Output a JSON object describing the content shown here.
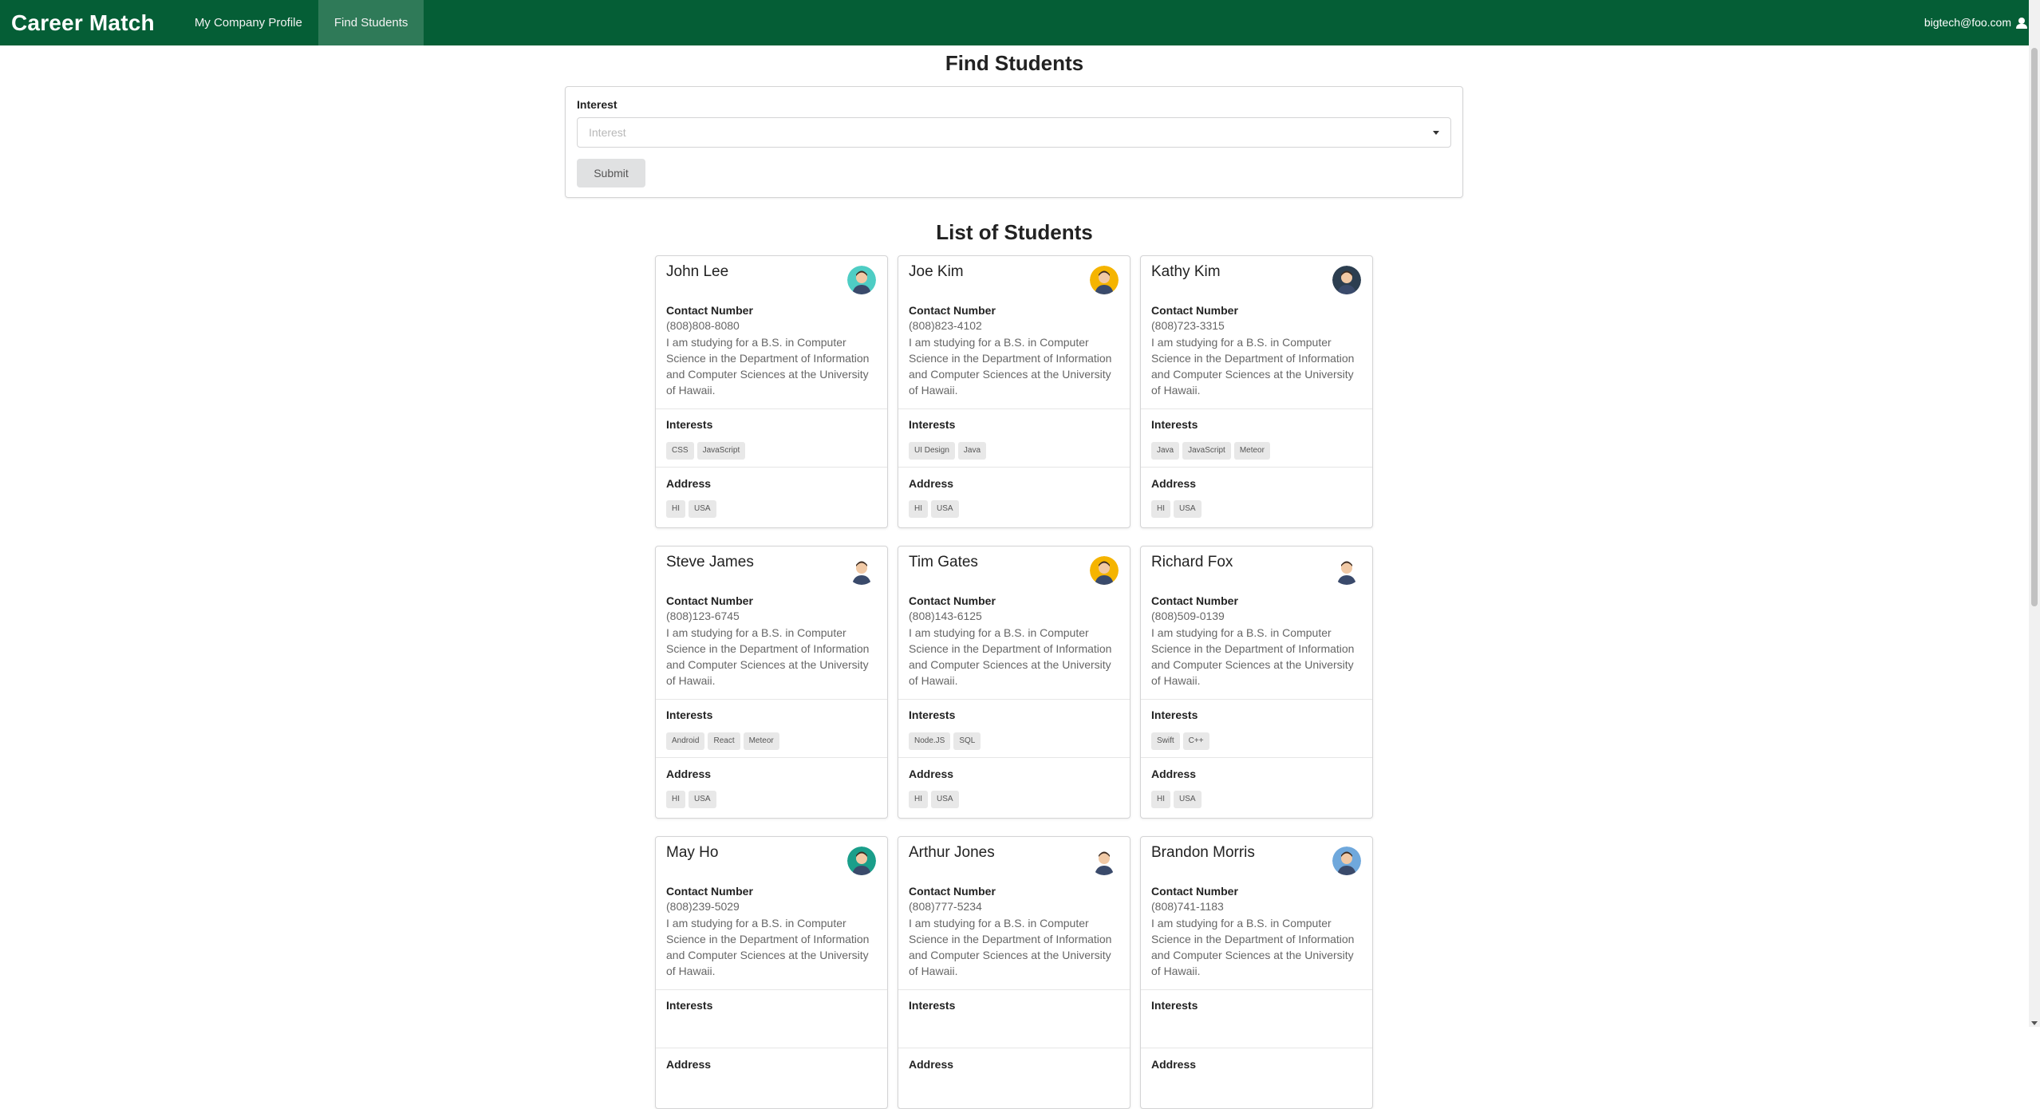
{
  "nav": {
    "brand": "Career Match",
    "items": [
      {
        "label": "My Company Profile"
      },
      {
        "label": "Find Students"
      }
    ],
    "user": "bigtech@foo.com"
  },
  "page_title": "Find Students",
  "form": {
    "label": "Interest",
    "placeholder": "Interest",
    "submit": "Submit"
  },
  "list_title": "List of Students",
  "labels": {
    "contact": "Contact Number",
    "interests": "Interests",
    "address": "Address"
  },
  "students": [
    {
      "name": "John Lee",
      "phone": "(808)808-8080",
      "bio": "I am studying for a B.S. in Computer Science in the Department of Information and Computer Sciences at the University of Hawaii.",
      "interests": [
        "CSS",
        "JavaScript"
      ],
      "address": [
        "HI",
        "USA"
      ],
      "avatar_color": "#4ecdc4",
      "avatar_icon": "avatar-man-glasses"
    },
    {
      "name": "Joe Kim",
      "phone": "(808)823-4102",
      "bio": "I am studying for a B.S. in Computer Science in the Department of Information and Computer Sciences at the University of Hawaii.",
      "interests": [
        "UI Design",
        "Java"
      ],
      "address": [
        "HI",
        "USA"
      ],
      "avatar_color": "#f5b400",
      "avatar_icon": "avatar-man-beard"
    },
    {
      "name": "Kathy Kim",
      "phone": "(808)723-3315",
      "bio": "I am studying for a B.S. in Computer Science in the Department of Information and Computer Sciences at the University of Hawaii.",
      "interests": [
        "Java",
        "JavaScript",
        "Meteor"
      ],
      "address": [
        "HI",
        "USA"
      ],
      "avatar_color": "#2c3e50",
      "avatar_icon": "avatar-woman"
    },
    {
      "name": "Steve James",
      "phone": "(808)123-6745",
      "bio": "I am studying for a B.S. in Computer Science in the Department of Information and Computer Sciences at the University of Hawaii.",
      "interests": [
        "Android",
        "React",
        "Meteor"
      ],
      "address": [
        "HI",
        "USA"
      ],
      "avatar_color": "#ffffff",
      "avatar_icon": "avatar-man-suit"
    },
    {
      "name": "Tim Gates",
      "phone": "(808)143-6125",
      "bio": "I am studying for a B.S. in Computer Science in the Department of Information and Computer Sciences at the University of Hawaii.",
      "interests": [
        "Node.JS",
        "SQL"
      ],
      "address": [
        "HI",
        "USA"
      ],
      "avatar_color": "#f5b400",
      "avatar_icon": "avatar-man"
    },
    {
      "name": "Richard Fox",
      "phone": "(808)509-0139",
      "bio": "I am studying for a B.S. in Computer Science in the Department of Information and Computer Sciences at the University of Hawaii.",
      "interests": [
        "Swift",
        "C++"
      ],
      "address": [
        "HI",
        "USA"
      ],
      "avatar_color": "#ffffff",
      "avatar_icon": "avatar-man-curly"
    },
    {
      "name": "May Ho",
      "phone": "(808)239-5029",
      "bio": "I am studying for a B.S. in Computer Science in the Department of Information and Computer Sciences at the University of Hawaii.",
      "interests": [],
      "address": [],
      "avatar_color": "#1a9e8a",
      "avatar_icon": "avatar-woman-dark"
    },
    {
      "name": "Arthur Jones",
      "phone": "(808)777-5234",
      "bio": "I am studying for a B.S. in Computer Science in the Department of Information and Computer Sciences at the University of Hawaii.",
      "interests": [],
      "address": [],
      "avatar_color": "#ffffff",
      "avatar_icon": "avatar-man-purple"
    },
    {
      "name": "Brandon Morris",
      "phone": "(808)741-1183",
      "bio": "I am studying for a B.S. in Computer Science in the Department of Information and Computer Sciences at the University of Hawaii.",
      "interests": [],
      "address": [],
      "avatar_color": "#6fa8dc",
      "avatar_icon": "avatar-man-red"
    }
  ]
}
